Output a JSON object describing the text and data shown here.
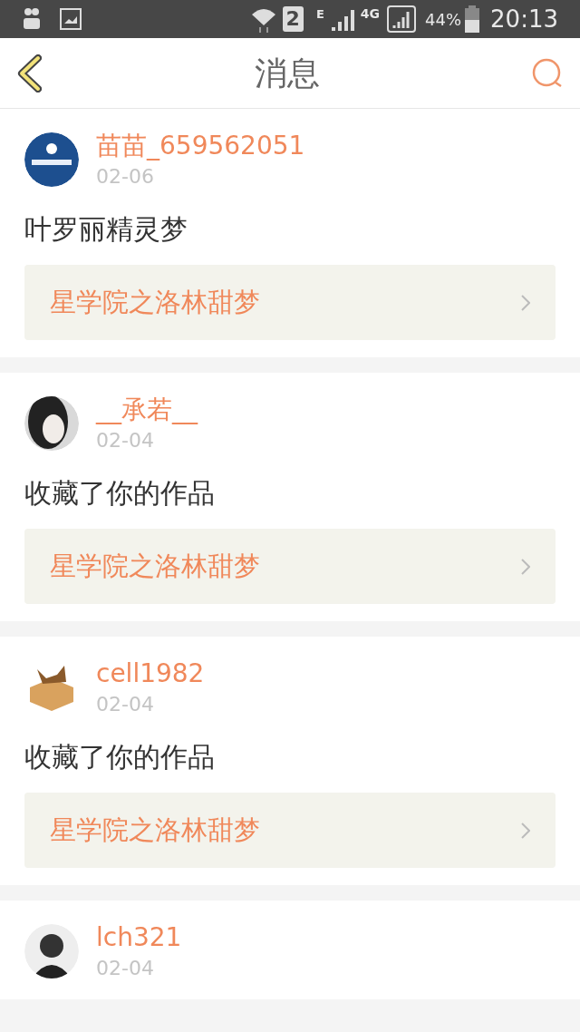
{
  "status_bar": {
    "sim_slot": "2",
    "network_e": "E",
    "network_4g": "4G",
    "battery": "44%",
    "time": "20:13"
  },
  "header": {
    "title": "消息"
  },
  "messages": [
    {
      "user": "苗苗_659562051",
      "date": "02-06",
      "text": "叶罗丽精灵梦",
      "work": "星学院之洛林甜梦"
    },
    {
      "user": "__承若__",
      "date": "02-04",
      "text": "收藏了你的作品",
      "work": "星学院之洛林甜梦"
    },
    {
      "user": "cell1982",
      "date": "02-04",
      "text": "收藏了你的作品",
      "work": "星学院之洛林甜梦"
    },
    {
      "user": "lch321",
      "date": "02-04"
    }
  ]
}
